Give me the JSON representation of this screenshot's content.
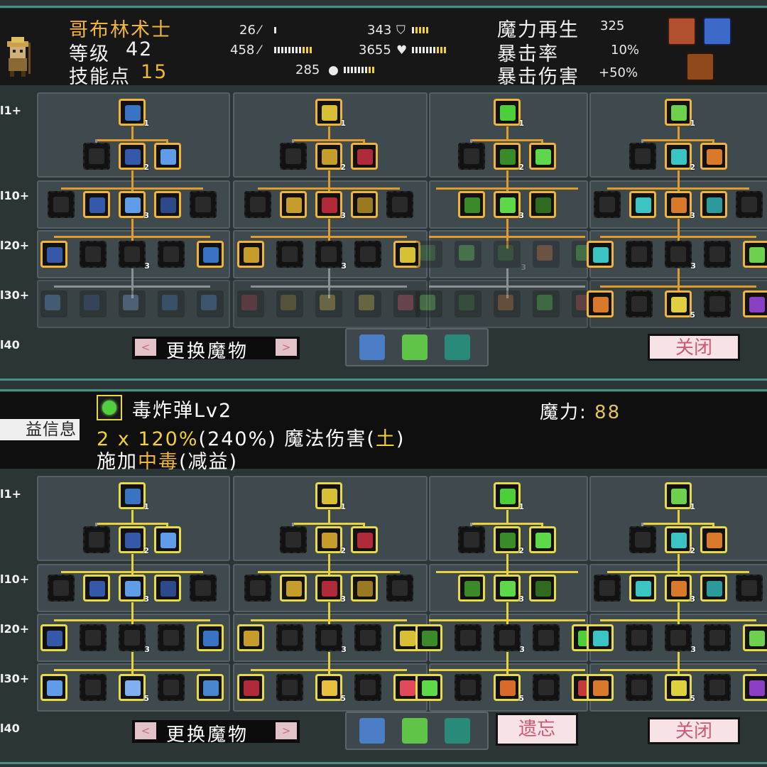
{
  "header": {
    "monster_name": "哥布林术士",
    "level_label": "等级",
    "level_value": "42",
    "skill_points_label": "技能点",
    "skill_points_value": "15",
    "stats": {
      "attack": "26",
      "magic": "458",
      "defense": "343",
      "hp": "3655",
      "speed": "285"
    },
    "mana_regen_label": "魔力再生",
    "mana_regen_value": "325",
    "crit_rate_label": "暴击率",
    "crit_rate_value": "10%",
    "crit_damage_label": "暴击伤害",
    "crit_damage_value": "+50%"
  },
  "rows": [
    "l1+",
    "l10+",
    "l20+",
    "l30+",
    "l40"
  ],
  "footer": {
    "change_monster_label": "更换魔物",
    "close_label": "关闭",
    "forget_label": "遗忘",
    "arrow_left": "<",
    "arrow_right": ">"
  },
  "tooltip": {
    "buff_tab_label": "益信息",
    "skill_name": "毒炸弹Lv2",
    "mana_label": "魔力:",
    "mana_value": "88",
    "line1_multiplier": "2 x ",
    "line1_percent": "120%",
    "line1_rest": "(240%) 魔法伤害(",
    "line1_element": "土",
    "line1_close": ")",
    "line2_prefix": "施加",
    "line2_status": "中毒",
    "line2_suffix": "(减益)"
  },
  "colors": {
    "accent_gold": "#f0b43a",
    "accent_yellow": "#e8da4a",
    "close_text": "#c95a79",
    "panel_border": "#4a8e84"
  }
}
